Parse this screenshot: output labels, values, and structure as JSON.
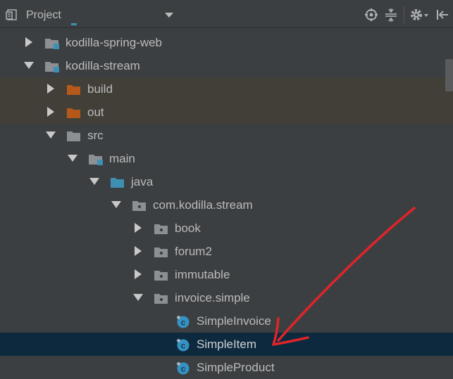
{
  "header": {
    "title": "Project",
    "icons": [
      "project-view-icon",
      "dropdown-arrow-icon",
      "locate-icon",
      "collapse-all-icon",
      "settings-gear-icon",
      "hide-panel-icon"
    ]
  },
  "colors": {
    "background": "#3c3f41",
    "excluded_row": "#423f39",
    "selected_row": "#0d293e",
    "excluded_folder": "#b4591a",
    "source_folder": "#3f8fb3",
    "class_icon": "#3592c4",
    "annotation_arrow": "#e0242a"
  },
  "tree": {
    "items": [
      {
        "label": "kodilla-spring-web",
        "state": "collapsed",
        "icon": "module-folder-icon"
      },
      {
        "label": "kodilla-stream",
        "state": "expanded",
        "icon": "module-folder-icon"
      },
      {
        "label": "build",
        "state": "collapsed",
        "icon": "excluded-folder-icon"
      },
      {
        "label": "out",
        "state": "collapsed",
        "icon": "excluded-folder-icon"
      },
      {
        "label": "src",
        "state": "expanded",
        "icon": "folder-icon"
      },
      {
        "label": "main",
        "state": "expanded",
        "icon": "module-folder-icon"
      },
      {
        "label": "java",
        "state": "expanded",
        "icon": "source-folder-icon"
      },
      {
        "label": "com.kodilla.stream",
        "state": "expanded",
        "icon": "package-icon"
      },
      {
        "label": "book",
        "state": "collapsed",
        "icon": "package-icon"
      },
      {
        "label": "forum2",
        "state": "collapsed",
        "icon": "package-icon"
      },
      {
        "label": "immutable",
        "state": "collapsed",
        "icon": "package-icon"
      },
      {
        "label": "invoice.simple",
        "state": "expanded",
        "icon": "package-icon"
      },
      {
        "label": "SimpleInvoice",
        "state": "leaf",
        "icon": "java-class-icon"
      },
      {
        "label": "SimpleItem",
        "state": "leaf",
        "icon": "java-class-icon",
        "selected": true
      },
      {
        "label": "SimpleProduct",
        "state": "leaf",
        "icon": "java-class-icon"
      }
    ]
  },
  "annotation": {
    "icon": "red-arrow-annotation-icon"
  }
}
